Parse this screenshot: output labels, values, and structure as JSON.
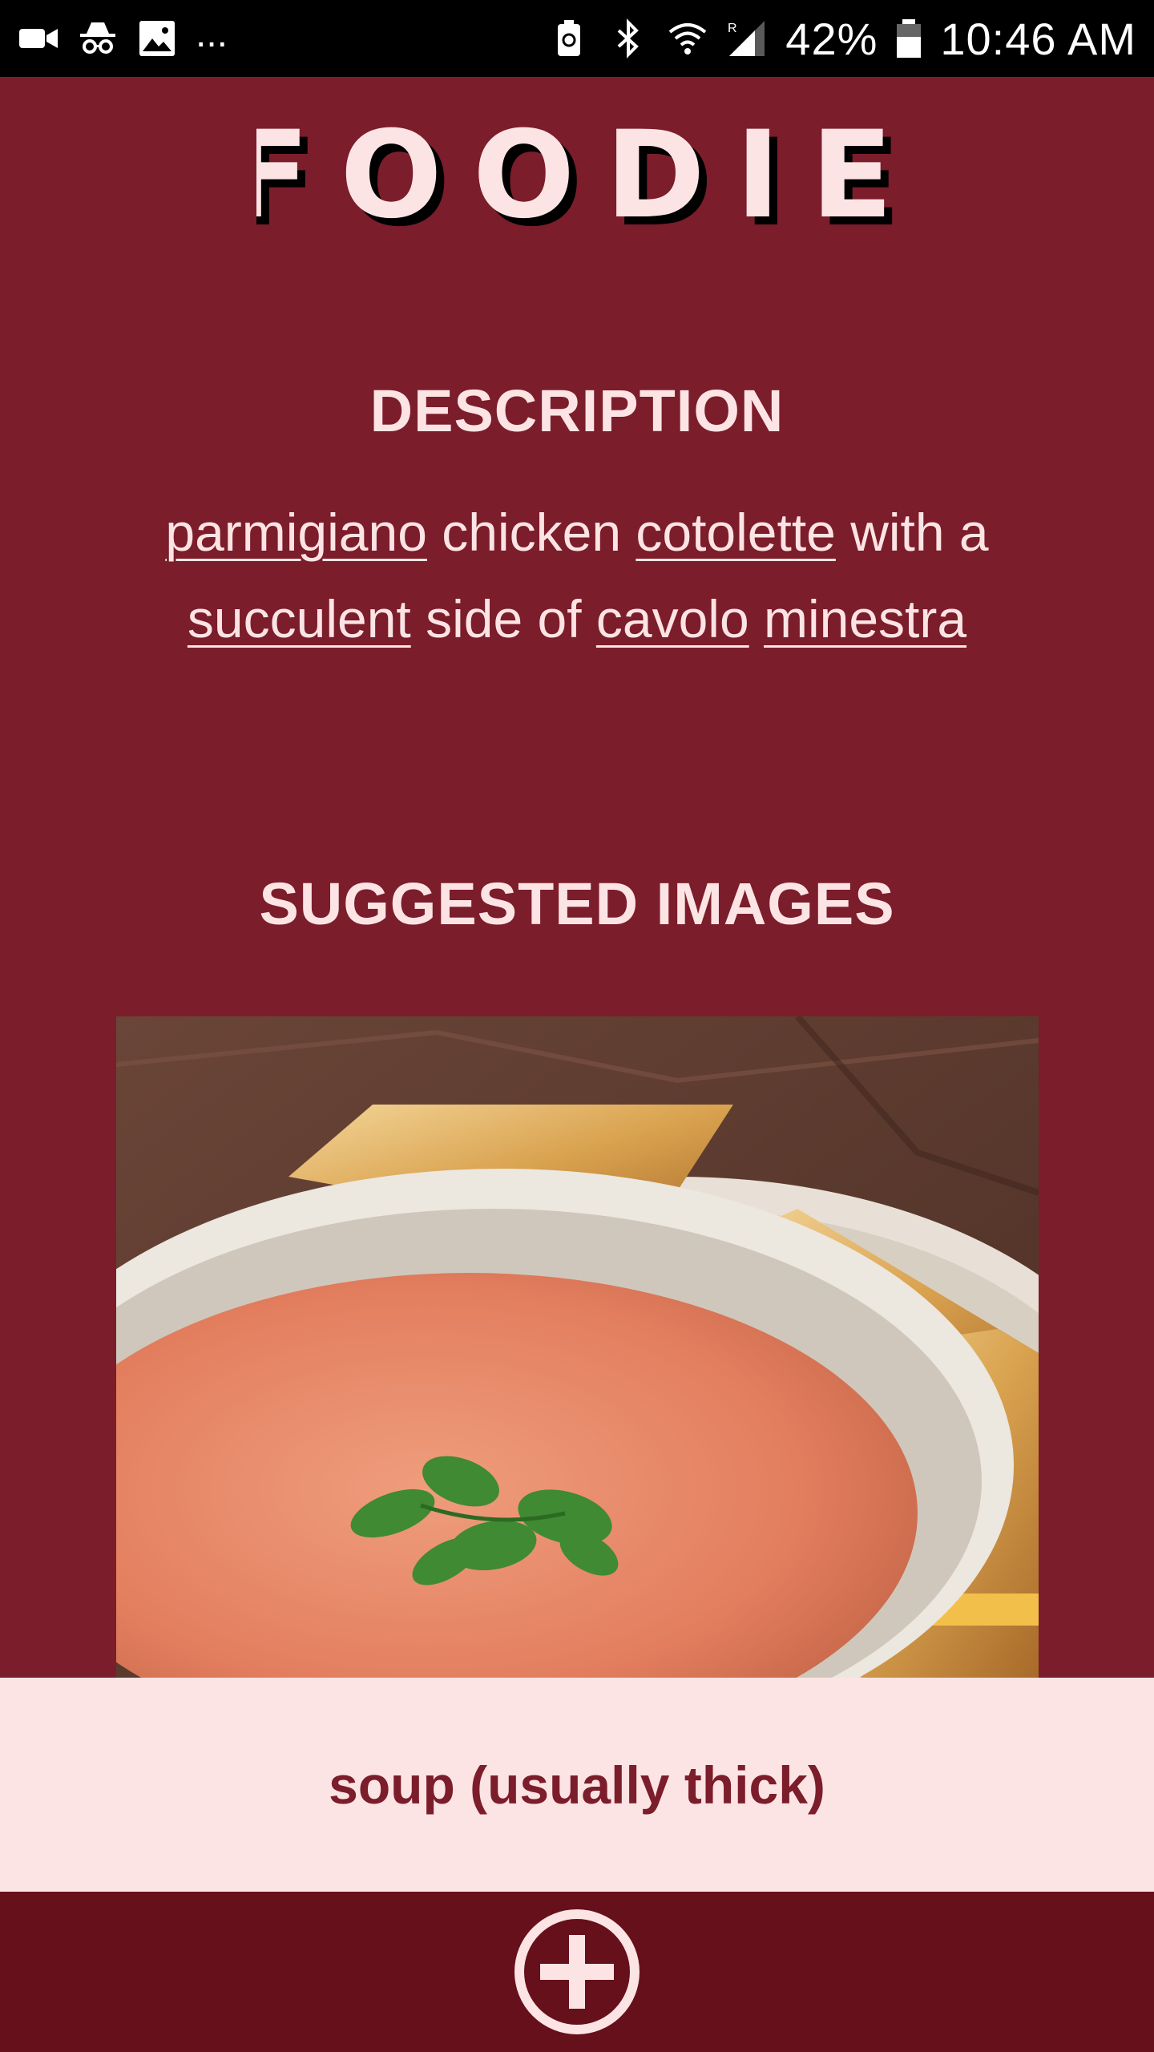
{
  "status_bar": {
    "battery": "42%",
    "time": "10:46 AM",
    "more": "...",
    "icons": [
      "video-icon",
      "incognito-icon",
      "image-icon",
      "battery-saver-icon",
      "bluetooth-icon",
      "wifi-icon",
      "signal-icon",
      "battery-icon"
    ]
  },
  "app": {
    "logo_text": "FOODIE",
    "colors": {
      "background": "#7b1d2b",
      "text_light": "#fde4e4",
      "bottom_bar": "#66101c"
    }
  },
  "description": {
    "heading": "DESCRIPTION",
    "words": [
      {
        "text": "parmigiano",
        "link": true
      },
      {
        "text": " chicken ",
        "link": false
      },
      {
        "text": "cotolette",
        "link": true
      },
      {
        "text": " with a ",
        "link": false
      },
      {
        "text": "succulent",
        "link": true
      },
      {
        "text": " side of ",
        "link": false
      },
      {
        "text": "cavolo",
        "link": true
      },
      {
        "text": " ",
        "link": false
      },
      {
        "text": "minestra",
        "link": true
      }
    ]
  },
  "suggested": {
    "heading": "SUGGESTED IMAGES",
    "image_caption": "soup (usually thick)"
  },
  "actions": {
    "add_icon": "plus-circle-icon"
  }
}
